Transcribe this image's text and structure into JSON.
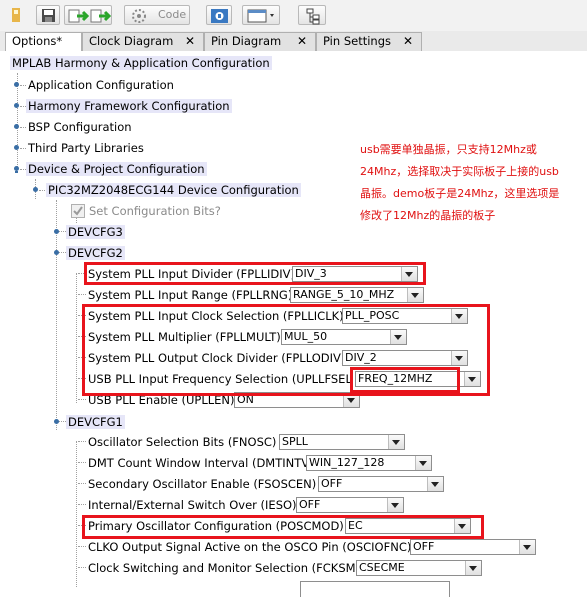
{
  "toolbar": {
    "code_label": "Code"
  },
  "tabs": [
    {
      "label": "Options*"
    },
    {
      "label": "Clock Diagram",
      "close": "✕"
    },
    {
      "label": "Pin Diagram",
      "close": "✕"
    },
    {
      "label": "Pin Settings",
      "close": "✕"
    }
  ],
  "tree": {
    "root": "MPLAB Harmony & Application Configuration",
    "app_config": "Application Configuration",
    "harmony_config": "Harmony Framework Configuration",
    "bsp_config": "BSP Configuration",
    "third_party": "Third Party Libraries",
    "device_project": "Device & Project Configuration",
    "device_config": "PIC32MZ2048ECG144 Device Configuration",
    "set_config_bits": "Set Configuration Bits?",
    "devcfg3": "DEVCFG3",
    "devcfg2": "DEVCFG2",
    "devcfg1": "DEVCFG1"
  },
  "devcfg2_props": [
    {
      "label": "System PLL Input Divider (FPLLIDIV)",
      "value": "DIV_3"
    },
    {
      "label": "System PLL Input Range (FPLLRNG)",
      "value": "RANGE_5_10_MHZ"
    },
    {
      "label": "System PLL Input Clock Selection (FPLLICLK)",
      "value": "PLL_POSC"
    },
    {
      "label": "System PLL Multiplier (FPLLMULT)",
      "value": "MUL_50"
    },
    {
      "label": "System PLL Output Clock Divider (FPLLODIV)",
      "value": "DIV_2"
    },
    {
      "label": "USB PLL Input Frequency Selection (UPLLFSEL",
      "value": "FREQ_12MHZ"
    },
    {
      "label": "USB PLL Enable (UPLLEN)",
      "value": "ON"
    }
  ],
  "devcfg1_props": [
    {
      "label": "Oscillator Selection Bits (FNOSC)",
      "value": "SPLL"
    },
    {
      "label": "DMT Count Window Interval (DMTINTV)",
      "value": "WIN_127_128"
    },
    {
      "label": "Secondary Oscillator Enable (FSOSCEN)",
      "value": "OFF"
    },
    {
      "label": "Internal/External Switch Over (IESO)",
      "value": "OFF"
    },
    {
      "label": "Primary Oscillator Configuration (POSCMOD)",
      "value": "EC"
    },
    {
      "label": "CLKO Output Signal Active on the OSCO Pin (OSCIOFNC)",
      "value": "OFF"
    },
    {
      "label": "Clock Switching and Monitor Selection (FCKSM)",
      "value": "CSECME"
    }
  ],
  "annotation": {
    "lines": [
      "usb需要单独晶振，只支持12Mhz或",
      "24Mhz，选择取决于实际板子上接的usb",
      "晶振。demo板子是24Mhz，这里选项是",
      "修改了12Mhz的晶振的板子"
    ]
  }
}
